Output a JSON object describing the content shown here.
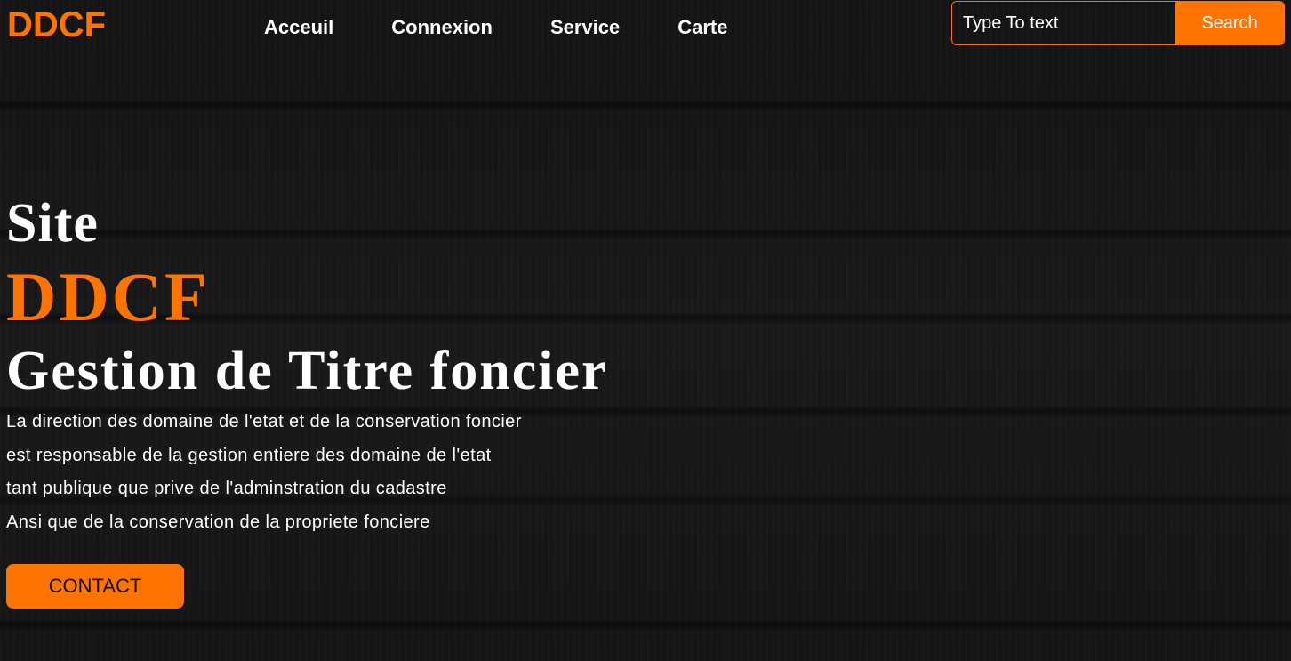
{
  "header": {
    "logo": "DDCF",
    "nav": [
      {
        "label": "Acceuil"
      },
      {
        "label": "Connexion"
      },
      {
        "label": "Service"
      },
      {
        "label": "Carte"
      }
    ],
    "search": {
      "placeholder": "Type To text",
      "button_label": "Search"
    }
  },
  "hero": {
    "line1": "Site",
    "line2": "DDCF",
    "line3": "Gestion de Titre foncier",
    "description": [
      "La direction des domaine de l'etat et de la conservation foncier",
      "est responsable de la gestion entiere des domaine de l'etat",
      "tant publique que prive de l'adminstration du cadastre",
      "Ansi que de la conservation de la propriete fonciere"
    ],
    "contact_label": "CONTACT"
  },
  "colors": {
    "accent": "#ff7300",
    "background": "#161616",
    "text": "#ffffff"
  }
}
